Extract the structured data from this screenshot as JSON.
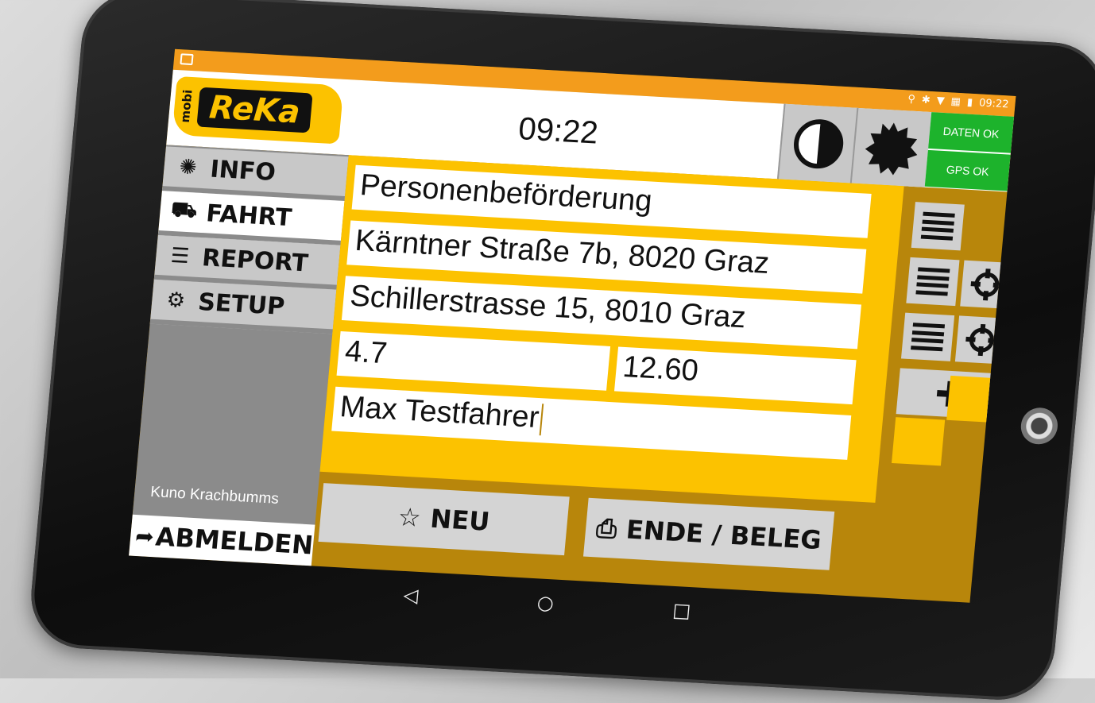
{
  "status_bar": {
    "time": "09:22",
    "icons": [
      "image-icon",
      "location-icon",
      "bluetooth-icon",
      "wifi-icon",
      "no-sim-icon",
      "battery-icon"
    ]
  },
  "header": {
    "logo_small": "mobi",
    "logo_main": "ReKa",
    "clock": "09:22",
    "contrast_button_icon": "contrast-icon",
    "brightness_button_icon": "brightness-icon",
    "data_status": "DATEN OK",
    "gps_status": "GPS OK"
  },
  "sidebar": {
    "items": [
      {
        "label": "INFO",
        "icon": "compass-icon"
      },
      {
        "label": "FAHRT",
        "icon": "car-icon",
        "active": true
      },
      {
        "label": "REPORT",
        "icon": "list-icon"
      },
      {
        "label": "SETUP",
        "icon": "gear-icon"
      }
    ],
    "user": "Kuno Krachbumms",
    "logout_label": "ABMELDEN"
  },
  "form": {
    "service_type": "Personenbeförderung",
    "pickup": "Kärntner Straße 7b, 8020 Graz",
    "destination": "Schillerstrasse 15, 8010 Graz",
    "distance": "4.7",
    "price": "12.60",
    "driver": "Max Testfahrer"
  },
  "actions": {
    "new_label": "NEU",
    "end_label": "ENDE / BELEG"
  },
  "colors": {
    "accent": "#fcc200",
    "status_bar": "#f39c1c",
    "ok_green": "#1db32c",
    "panel_gray": "#8b8b8b"
  }
}
